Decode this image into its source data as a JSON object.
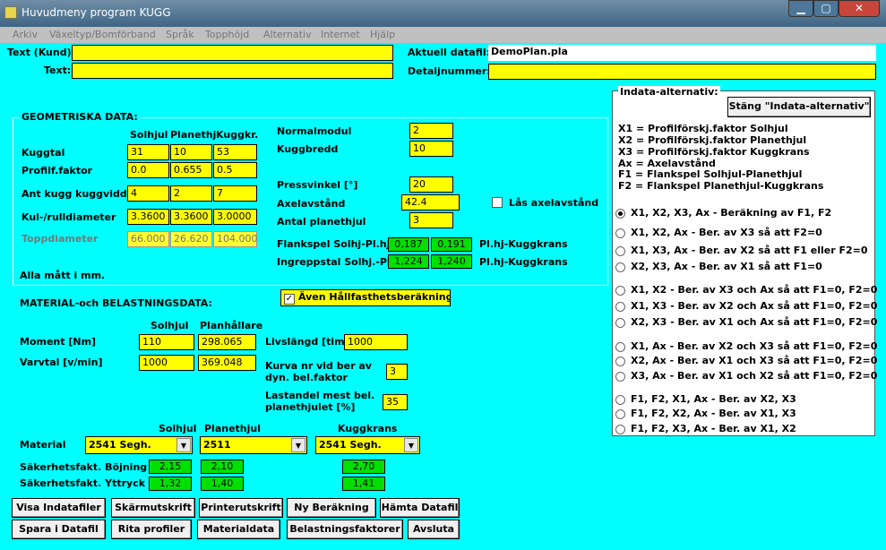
{
  "window": {
    "title": "Huvudmeny program KUGG"
  },
  "menu": [
    "Arkiv",
    "Växeltyp/Bomförband",
    "Språk",
    "Topphöjd",
    "Alternativ",
    "Internet",
    "Hjälp"
  ],
  "top": {
    "text_kund_label": "Text (Kund):",
    "text_label": "Text:",
    "datafil_label": "Aktuell datafil:",
    "datafil_value": "DemoPlan.pla",
    "detalj_label": "Detaljnummer:"
  },
  "geo": {
    "title": "GEOMETRISKA DATA:",
    "col1": "Solhjul",
    "col2": "Planethj.",
    "col3": "Kuggkr.",
    "kuggtal_label": "Kuggtal",
    "kuggtal": [
      "31",
      "10",
      "53"
    ],
    "profil_label": "Profilf.faktor",
    "profil": [
      "0.0",
      "0.655",
      "0.5"
    ],
    "antkugg_label": "Ant kugg kuggvidd",
    "antkugg": [
      "4",
      "2",
      "7"
    ],
    "kul_label": "Kul-/rulldiameter",
    "kul": [
      "3.3600",
      "3.3600",
      "3.0000"
    ],
    "topp_label": "Toppdiameter",
    "topp": [
      "66.000",
      "26.620",
      "104.000"
    ],
    "mm_note": "Alla mått i mm.",
    "normalmodul_label": "Normalmodul",
    "normalmodul": "2",
    "kuggbredd_label": "Kuggbredd",
    "kuggbredd": "10",
    "press_label": "Pressvinkel [°]",
    "press": "20",
    "axel_label": "Axelavstånd",
    "axel": "42.4",
    "las_label": "Lås axelavstånd",
    "antal_label": "Antal planethjul",
    "antal": "3",
    "flank_label": "Flankspel Solhj-Pl.hj",
    "flank": [
      "0,187",
      "0,191"
    ],
    "flank_right": "Pl.hj-Kuggkrans",
    "ingrep_label": "Ingreppstal Solhj.-Pl.",
    "ingrep": [
      "1,224",
      "1,240"
    ],
    "ingrep_right": "Pl.hj-Kuggkrans"
  },
  "mat": {
    "title": "MATERIAL-och BELASTNINGSDATA:",
    "haall_label": "Även Hållfasthetsberäkning",
    "col_sol": "Solhjul",
    "col_plan": "Planhållare",
    "moment_label": "Moment [Nm]",
    "moment": [
      "110",
      "298.065"
    ],
    "varvtal_label": "Varvtal [v/min]",
    "varvtal": [
      "1000",
      "369.048"
    ],
    "livs_label": "Livslängd [tim]",
    "livs": "1000",
    "kurva_label1": "Kurva nr vid ber av",
    "kurva_label2": "dyn. bel.faktor",
    "kurva": "3",
    "last_label1": "Lastandel mest bel.",
    "last_label2": "planethjulet [%]",
    "last": "35",
    "h_sol": "Solhjul",
    "h_plan": "Planethjul",
    "h_kugg": "Kuggkrans",
    "material_label": "Material",
    "materials": [
      "2541 Segh.",
      "2511",
      "2541 Segh."
    ],
    "bojn_label": "Säkerhetsfakt. Böjning",
    "bojn": [
      "2,15",
      "2,10",
      "2,70"
    ],
    "yttr_label": "Säkerhetsfakt. Yttryck",
    "yttr": [
      "1,32",
      "1,40",
      "1,41"
    ]
  },
  "buttons": [
    "Visa Indatafiler",
    "Skärmutskrift",
    "Printerutskrift",
    "Ny Beräkning",
    "Hämta Datafil",
    "Spara i Datafil",
    "Rita profiler",
    "Materialdata",
    "Belastningsfaktorer",
    "Avsluta"
  ],
  "panel": {
    "title": "Indata-alternativ:",
    "close": "Stäng \"Indata-alternativ\"",
    "legend": [
      "X1 = Profilförskj.faktor Solhjul",
      "X2 = Profilförskj.faktor Planethjul",
      "X3 = Profilförskj.faktor Kuggkrans",
      "Ax = Axelavstånd",
      "F1 = Flankspel Solhjul-Planethjul",
      "F2 = Flankspel Planethjul-Kuggkrans"
    ],
    "options": [
      "X1, X2, X3, Ax  -  Beräkning av F1, F2",
      "X1, X2, Ax  - Ber. av X3 så att F2=0",
      "X1, X3, Ax  - Ber. av X2 så att F1 eller F2=0",
      "X2, X3, Ax  - Ber. av X1 så att F1=0",
      "X1, X2  - Ber. av X3 och Ax så att F1=0, F2=0",
      "X1, X3  - Ber. av X2 och Ax så att F1=0, F2=0",
      "X2, X3  - Ber. av X1 och Ax så att F1=0, F2=0",
      "X1, Ax  - Ber. av X2 och X3 så att F1=0, F2=0",
      "X2, Ax  - Ber. av X1 och X3 så att F1=0, F2=0",
      "X3, Ax  - Ber. av X1 och X2 så att F1=0, F2=0",
      "F1, F2, X1, Ax  - Ber. av X2, X3",
      "F1, F2, X2, Ax  - Ber. av X1, X3",
      "F1, F2, X3, Ax  - Ber. av X1, X2"
    ],
    "selected": 0
  },
  "colors": {
    "background": "#00ffff",
    "field": "#ffff00",
    "result": "#00e000"
  }
}
